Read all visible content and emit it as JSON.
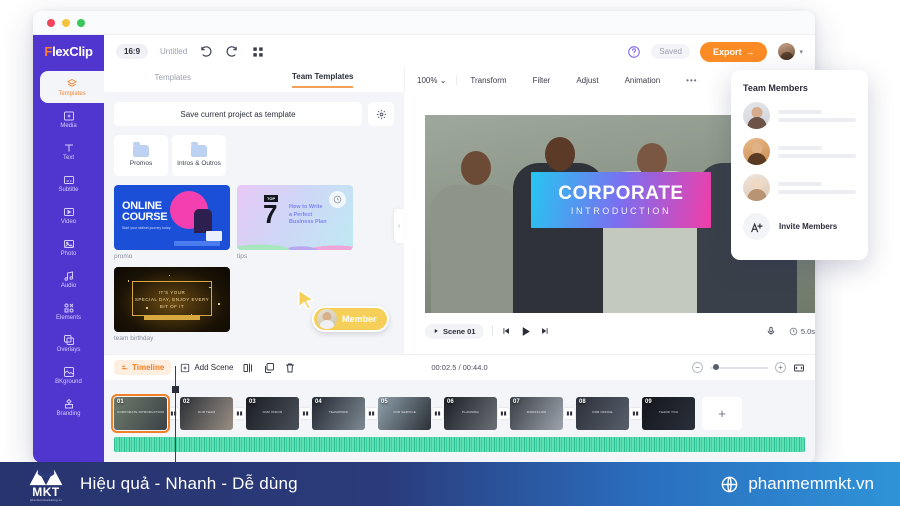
{
  "window": {
    "traffic_lights": [
      "close",
      "minimize",
      "maximize"
    ]
  },
  "brand": {
    "f": "F",
    "rest": "lexClip"
  },
  "header": {
    "aspect_ratio": "16:9",
    "project_name": "Untitled",
    "undo_icon": "undo-icon",
    "redo_icon": "redo-icon",
    "grid_icon": "grid-icon",
    "help_icon": "help-icon",
    "saved_label": "Saved",
    "export_label": "Export",
    "export_arrow": "→",
    "avatar_chevron": "▾"
  },
  "sidebar": {
    "items": [
      {
        "label": "Templates",
        "icon": "templates-icon",
        "active": true
      },
      {
        "label": "Media",
        "icon": "media-icon",
        "active": false
      },
      {
        "label": "Text",
        "icon": "text-icon",
        "active": false
      },
      {
        "label": "Subtitle",
        "icon": "subtitle-icon",
        "active": false
      },
      {
        "label": "Video",
        "icon": "video-icon",
        "active": false
      },
      {
        "label": "Photo",
        "icon": "photo-icon",
        "active": false
      },
      {
        "label": "Audio",
        "icon": "audio-icon",
        "active": false
      },
      {
        "label": "Elements",
        "icon": "elements-icon",
        "active": false
      },
      {
        "label": "Overlays",
        "icon": "overlays-icon",
        "active": false
      },
      {
        "label": "BKground",
        "icon": "background-icon",
        "active": false
      },
      {
        "label": "Branding",
        "icon": "branding-icon",
        "active": false
      }
    ]
  },
  "panel_tabs": [
    {
      "label": "Templates",
      "active": false
    },
    {
      "label": "Team Templates",
      "active": true
    }
  ],
  "toolbar": {
    "zoom_level": "100%",
    "zoom_caret": "⌄",
    "items": [
      "Transform",
      "Filter",
      "Adjust",
      "Animation"
    ],
    "more_label": "•••"
  },
  "left_panel": {
    "save_template_label": "Save current project as template",
    "settings_icon": "gear-icon",
    "folders": [
      {
        "label": "Promos",
        "icon": "folder-icon"
      },
      {
        "label": "Intros & Outros",
        "icon": "folder-icon"
      }
    ],
    "templates": [
      {
        "label": "promo",
        "thumb_title": "ONLINE",
        "thumb_title2": "COURSE",
        "thumb_sub": "Start your skillset journey today"
      },
      {
        "label": "tips",
        "top_badge": "TOP",
        "number": "7",
        "line1": "How to Write",
        "line2": "a Perfect",
        "line3": "Business Plan"
      },
      {
        "label": "team birthday",
        "line1": "IT'S YOUR",
        "line2": "SPECIAL DAY, ENJOY EVERY",
        "line3": "BIT OF IT"
      }
    ],
    "collapse_icon": "chevron-left-icon"
  },
  "canvas": {
    "title_main": "CORPORATE",
    "title_sub": "INTRODUCTION",
    "gradient_start": "#26c6f0",
    "gradient_end": "#f13ea8"
  },
  "player": {
    "scene_label": "Scene 01",
    "play_icon": "play-icon",
    "prev_icon": "skip-previous-icon",
    "next_icon": "skip-next-icon",
    "mic_icon": "microphone-icon",
    "clock_icon": "clock-icon",
    "duration": "5.0s"
  },
  "timeline": {
    "tab_label": "Timeline",
    "tab_icon": "timeline-icon",
    "add_scene_label": "Add Scene",
    "add_icon": "plus-box-icon",
    "split_icon": "split-icon",
    "duplicate_icon": "duplicate-icon",
    "delete_icon": "trash-icon",
    "time_display": "00:02.5 / 00:44.0",
    "zoom_out_icon": "minus-circle-icon",
    "zoom_in_icon": "plus-circle-icon",
    "fit_icon": "fit-to-width-icon",
    "add_clip_label": "+",
    "clips": [
      {
        "number": "01",
        "caption": "CORPORATE INTRODUCTION",
        "selected": true
      },
      {
        "number": "02",
        "caption": "OUR TEAM",
        "selected": false
      },
      {
        "number": "03",
        "caption": "OUR VISION",
        "selected": false
      },
      {
        "number": "04",
        "caption": "TEAMWORK",
        "selected": false
      },
      {
        "number": "05",
        "caption": "OUR SERVICE",
        "selected": false
      },
      {
        "number": "06",
        "caption": "PLANNING",
        "selected": false
      },
      {
        "number": "07",
        "caption": "WORKFLOW",
        "selected": false
      },
      {
        "number": "08",
        "caption": "OUR OFFICE",
        "selected": false
      },
      {
        "number": "09",
        "caption": "THANK YOU",
        "selected": false
      }
    ]
  },
  "team_popup": {
    "title": "Team Members",
    "members": [
      {
        "avatar": "member-avatar-1"
      },
      {
        "avatar": "member-avatar-2"
      },
      {
        "avatar": "member-avatar-3"
      }
    ],
    "invite_label": "Invite Members",
    "invite_icon": "add-person-icon"
  },
  "cursor_badge": {
    "label": "Member",
    "color": "#f5cf58"
  },
  "banner": {
    "logo_word": "MKT",
    "logo_tiny": "phanmemmarketing.vn",
    "slogan": "Hiệu quả - Nhanh - Dễ dùng",
    "site": "phanmemmkt.vn",
    "globe_icon": "globe-icon"
  }
}
